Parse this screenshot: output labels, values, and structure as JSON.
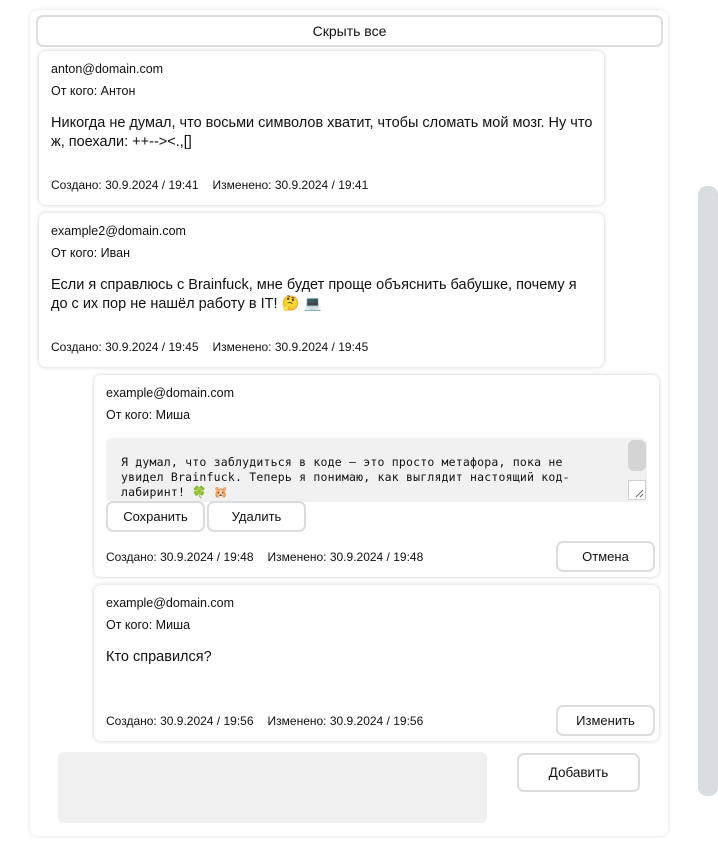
{
  "toolbar": {
    "hide_all_label": "Скрыть все"
  },
  "messages": [
    {
      "email": "anton@domain.com",
      "from": "От кого: Антон",
      "text": "Никогда не думал, что восьми символов хватит, чтобы сломать мой мозг. Ну что ж, поехали: ++-->&lt;.,[]",
      "created": "Создано: 30.9.2024 / 19:41",
      "modified": "Изменено: 30.9.2024 / 19:41"
    },
    {
      "email": "example2@domain.com",
      "from": "От кого: Иван",
      "text": "Если я справлюсь с Brainfuck, мне будет проще объяснить бабушке, почему я до с их пор не нашёл работу в IT! 🤔 💻",
      "created": "Создано: 30.9.2024 / 19:45",
      "modified": "Изменено: 30.9.2024 / 19:45"
    },
    {
      "email": "example@domain.com",
      "from": "От кого: Миша",
      "editor_text": "Я думал, что заблудиться в коде — это просто метафора, пока не увидел Brainfuck. Теперь я понимаю, как выглядит настоящий код-лабиринт! 🍀 🐹",
      "save_label": "Сохранить",
      "delete_label": "Удалить",
      "cancel_label": "Отмена",
      "created": "Создано: 30.9.2024 / 19:48",
      "modified": "Изменено: 30.9.2024 / 19:48"
    },
    {
      "email": "example@domain.com",
      "from": "От кого: Миша",
      "text": "Кто справился?",
      "edit_label": "Изменить",
      "created": "Создано: 30.9.2024 / 19:56",
      "modified": "Изменено: 30.9.2024 / 19:56"
    }
  ],
  "composer": {
    "add_label": "Добавить"
  },
  "colors": {
    "card_shadow": "#cccccc",
    "button_border": "#dcdcdc",
    "editor_bg": "#f1f1f1",
    "scrollbar": "#d8dde0"
  }
}
